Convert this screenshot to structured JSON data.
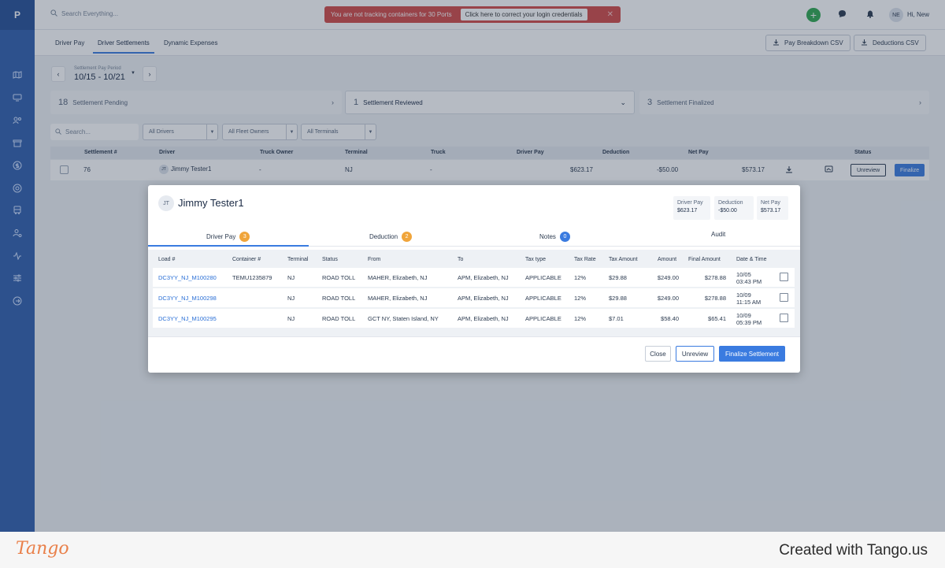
{
  "logo": "P",
  "topbar": {
    "search_placeholder": "Search Everything...",
    "alert_text": "You are not tracking containers for 30 Ports",
    "alert_link": "Click here to correct your login credentials",
    "add_label": "+",
    "user_initials": "NE",
    "greeting": "Hi, New"
  },
  "tabs": [
    "Driver Pay",
    "Driver Settlements",
    "Dynamic Expenses"
  ],
  "csv_buttons": [
    "Pay Breakdown CSV",
    "Deductions CSV"
  ],
  "period": {
    "label": "Settlement Pay Period",
    "value": "10/15 - 10/21"
  },
  "status_cards": [
    {
      "count": "18",
      "label": "Settlement Pending"
    },
    {
      "count": "1",
      "label": "Settlement Reviewed"
    },
    {
      "count": "3",
      "label": "Settlement Finalized"
    }
  ],
  "filters": {
    "search_placeholder": "Search...",
    "drivers": "All Drivers",
    "fleet_owners": "All Fleet Owners",
    "terminals": "All Terminals"
  },
  "table": {
    "headers": [
      "Settlement #",
      "Driver",
      "Truck Owner",
      "Terminal",
      "Truck",
      "Driver Pay",
      "Deduction",
      "Net Pay",
      "Status"
    ],
    "row": {
      "settlement": "76",
      "driver_initials": "JT",
      "driver": "Jimmy Tester1",
      "truck_owner": "-",
      "terminal": "NJ",
      "truck": "-",
      "driver_pay": "$623.17",
      "deduction": "-$50.00",
      "net_pay": "$573.17",
      "unreview": "Unreview",
      "finalize": "Finalize"
    }
  },
  "modal": {
    "initials": "JT",
    "name": "Jimmy Tester1",
    "summary": [
      {
        "label": "Driver Pay",
        "value": "$623.17"
      },
      {
        "label": "Deduction",
        "value": "-$50.00"
      },
      {
        "label": "Net Pay",
        "value": "$573.17"
      }
    ],
    "tabs": [
      {
        "label": "Driver Pay",
        "badge": "3",
        "badge_color": "#f0a53b"
      },
      {
        "label": "Deduction",
        "badge": "2",
        "badge_color": "#f0a53b"
      },
      {
        "label": "Notes",
        "badge": "0",
        "badge_color": "#3a7be0"
      },
      {
        "label": "Audit",
        "badge": ""
      }
    ],
    "headers": [
      "Load #",
      "Container #",
      "Terminal",
      "Status",
      "From",
      "To",
      "Tax type",
      "Tax Rate",
      "Tax Amount",
      "Amount",
      "Final Amount",
      "Date & Time"
    ],
    "rows": [
      {
        "load": "DC3YY_NJ_M100280",
        "container": "TEMU1235879",
        "terminal": "NJ",
        "status": "ROAD TOLL",
        "from": "MAHER, Elizabeth, NJ",
        "to": "APM, Elizabeth, NJ",
        "tax_type": "APPLICABLE",
        "tax_rate": "12%",
        "tax_amount": "$29.88",
        "amount": "$249.00",
        "final_amount": "$278.88",
        "date": "10/05",
        "time": "03:43 PM"
      },
      {
        "load": "DC3YY_NJ_M100298",
        "container": "",
        "terminal": "NJ",
        "status": "ROAD TOLL",
        "from": "MAHER, Elizabeth, NJ",
        "to": "APM, Elizabeth, NJ",
        "tax_type": "APPLICABLE",
        "tax_rate": "12%",
        "tax_amount": "$29.88",
        "amount": "$249.00",
        "final_amount": "$278.88",
        "date": "10/09",
        "time": "11:15 AM"
      },
      {
        "load": "DC3YY_NJ_M100295",
        "container": "",
        "terminal": "NJ",
        "status": "ROAD TOLL",
        "from": "GCT NY, Staten Island, NY",
        "to": "APM, Elizabeth, NJ",
        "tax_type": "APPLICABLE",
        "tax_rate": "12%",
        "tax_amount": "$7.01",
        "amount": "$58.40",
        "final_amount": "$65.41",
        "date": "10/09",
        "time": "05:39 PM"
      }
    ],
    "close": "Close",
    "unreview": "Unreview",
    "finalize": "Finalize Settlement"
  },
  "footer": {
    "logo": "Tango",
    "text": "Created with Tango.us"
  }
}
